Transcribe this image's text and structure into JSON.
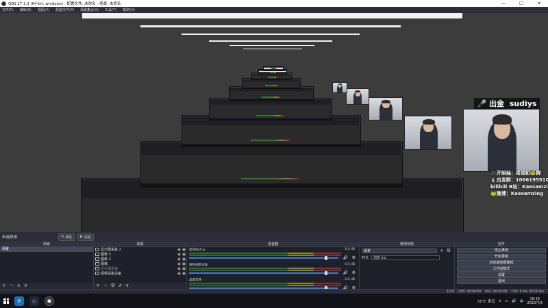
{
  "window": {
    "title": "OBS 27.1.3 (64-bit, windows) - 配置文件: 未命名 - 场景: 未命名",
    "min": "—",
    "max": "☐",
    "close": "✕"
  },
  "menu": [
    "文件(F)",
    "编辑(E)",
    "视图(V)",
    "配置文件(P)",
    "场景集合(S)",
    "工具(T)",
    "帮助(H)"
  ],
  "overlay": {
    "tag": "🎤 出金",
    "name": "sudiys",
    "lines": [
      "🎥开始抽：诺诺和🐸群",
      "🐧白发群：1066195510",
      "bilibili B站：Kaesamzing",
      "🐸微博：Kaesamzing"
    ]
  },
  "scene_bar": {
    "current": "未选择源",
    "properties": "属性",
    "filters": "滤镜"
  },
  "scenes": {
    "header": "场景",
    "items": [
      "场景"
    ]
  },
  "sources": {
    "header": "来源",
    "items": [
      {
        "label": "显示器采集 2",
        "dim": false
      },
      {
        "label": "图像 3",
        "dim": false
      },
      {
        "label": "图像 2",
        "dim": false
      },
      {
        "label": "图像",
        "dim": false
      },
      {
        "label": "显示器采集",
        "dim": true
      },
      {
        "label": "视频采集设备",
        "dim": false
      }
    ]
  },
  "mixer": {
    "header": "混音器",
    "tracks": [
      {
        "name": "麦克风/Aux",
        "db": "0.0 dB",
        "level": 0.93
      },
      {
        "name": "视频采集设备",
        "db": "0.0 dB",
        "level": 0.93
      },
      {
        "name": "桌面音频",
        "db": "0.0 dB",
        "level": 0.93
      }
    ]
  },
  "transitions": {
    "header": "转场特效",
    "type": "渐变",
    "duration_label": "时长",
    "duration": "300 ms"
  },
  "controls": {
    "header": "控件",
    "buttons": [
      "停止推流",
      "开始录制",
      "启动虚拟摄像机",
      "工作室模式",
      "设置",
      "退出"
    ]
  },
  "status": {
    "frames": "1219",
    "live": "LIVE: 00:00:00",
    "rec": "REC: 00:00:00",
    "cpu": "CPU: 0.6%, 60.00 fps"
  },
  "taskbar": {
    "weather": "31°C 多云",
    "time": "16:16",
    "date": "2022/7/3",
    "lang": "中"
  },
  "footer_icons": [
    "+",
    "−",
    "∧",
    "∨"
  ],
  "colors": {
    "accent": "#3d7bd9",
    "dock_bg": "#1e2129",
    "chrome": "#2b2e38"
  }
}
